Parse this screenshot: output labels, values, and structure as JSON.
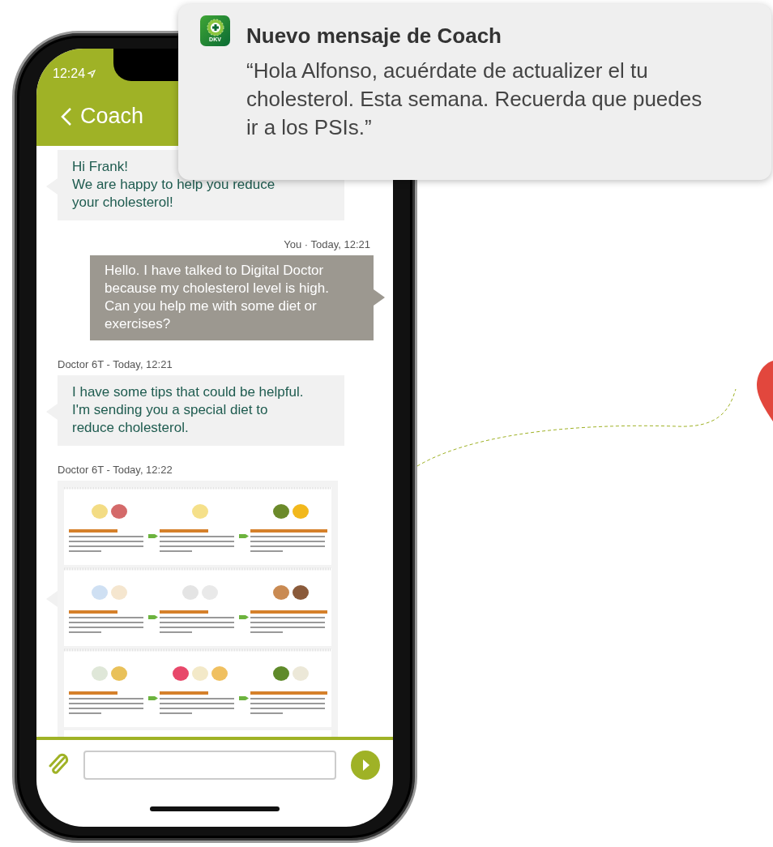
{
  "notification": {
    "app_logo": "DKV",
    "title": "Nuevo mensaje de Coach",
    "body": "“Hola Alfonso, acuérdate de actualizer el tu cholesterol. Esta semana. Recuerda que puedes ir a los PSIs.”"
  },
  "status_bar": {
    "time": "12:24"
  },
  "header": {
    "title": "Coach"
  },
  "messages": [
    {
      "kind": "received",
      "text": "Hi Frank!\nWe are happy to help you reduce your cholesterol!"
    },
    {
      "kind": "sent",
      "meta": "You · Today, 12:21",
      "text": "Hello. I have talked to Digital Doctor because my cholesterol level is high. Can you help me with some diet or exercises?"
    },
    {
      "kind": "received",
      "meta": "Doctor 6T - Today, 12:21",
      "text": "I have some tips that could be helpful. I'm sending you a special diet to reduce cholesterol."
    },
    {
      "kind": "received_image",
      "meta": "Doctor 6T - Today, 12:22"
    }
  ]
}
